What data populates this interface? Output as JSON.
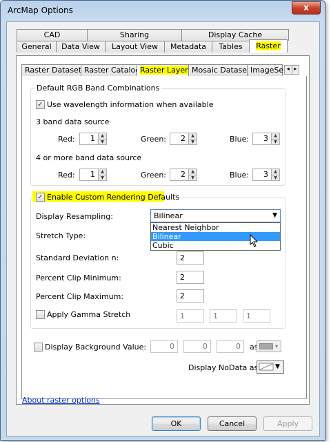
{
  "window": {
    "title": "ArcMap Options",
    "close_glyph": "x"
  },
  "tabs_row1": [
    "CAD",
    "Sharing",
    "Display Cache"
  ],
  "tabs_row2": [
    "General",
    "Data View",
    "Layout View",
    "Metadata",
    "Tables",
    "Raster"
  ],
  "subtabs": [
    "Raster Dataset",
    "Raster Catalog",
    "Raster Layer",
    "Mosaic Dataset",
    "ImageSe"
  ],
  "subtab_scroll": {
    "left": "◂",
    "right": "▸"
  },
  "rgb_group": {
    "title": "Default RGB Band Combinations",
    "use_wavelength_label": "Use wavelength information when available",
    "use_wavelength_checked": true,
    "three_band_title": "3 band data source",
    "four_band_title": "4 or more band data source",
    "red_label": "Red:",
    "green_label": "Green:",
    "blue_label": "Blue:",
    "three_band": {
      "red": "1",
      "green": "2",
      "blue": "3"
    },
    "four_band": {
      "red": "1",
      "green": "2",
      "blue": "3"
    }
  },
  "rendering": {
    "enable_label": "Enable Custom Rendering Defaults",
    "enable_checked": true,
    "resampling_label": "Display Resampling:",
    "resampling_value": "Bilinear",
    "resampling_options": [
      "Nearest Neighbor",
      "Bilinear",
      "Cubic"
    ],
    "stretch_label": "Stretch Type:",
    "stddev_label": "Standard Deviation n:",
    "stddev_value": "2",
    "clip_min_label": "Percent Clip Minimum:",
    "clip_min_value": "2",
    "clip_max_label": "Percent Clip Maximum:",
    "clip_max_value": "2",
    "gamma_label": "Apply Gamma Stretch",
    "gamma_checked": false,
    "gamma_values": [
      "1",
      "1",
      "1"
    ]
  },
  "background": {
    "label": "Display Background Value:",
    "checked": false,
    "values": [
      "0",
      "0",
      "0"
    ],
    "as_label": "as",
    "nodata_label": "Display NoData as"
  },
  "footer": {
    "link": "About raster options",
    "ok": "OK",
    "cancel": "Cancel",
    "apply": "Apply"
  },
  "colors": {
    "highlight": "#ffff00",
    "selection": "#3399ff",
    "link": "#0033cc"
  }
}
